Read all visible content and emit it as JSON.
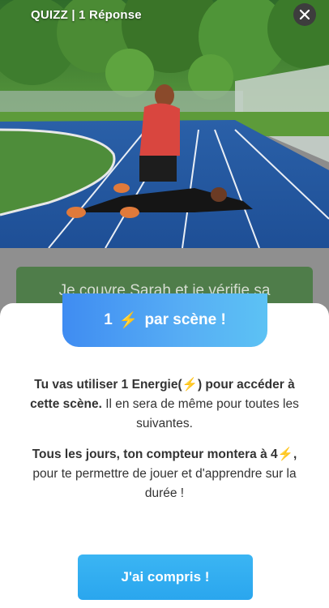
{
  "header": {
    "title": "QUIZZ | 1 Réponse"
  },
  "scene": {
    "description_icon": "accident-scene-image"
  },
  "answer": {
    "label": "Je couvre Sarah et je vérifie sa"
  },
  "sheet": {
    "pill_count": "1",
    "pill_text": "par scène !",
    "bolt": "⚡",
    "p1_a": "Tu vas utiliser 1 Energie(",
    "p1_b": ") pour accéder à cette scène.",
    "p1_c": " Il en sera de même pour toutes les suivantes.",
    "p2_a": "Tous les jours, ton compteur montera à 4",
    "p2_b": ",",
    "p2_c": " pour te permettre de jouer et d'apprendre sur la durée !",
    "button_label": "J'ai compris !"
  },
  "colors": {
    "accent": "#2aa6ee",
    "answer_green": "#4f7d4a",
    "bolt": "#f3b52d"
  }
}
